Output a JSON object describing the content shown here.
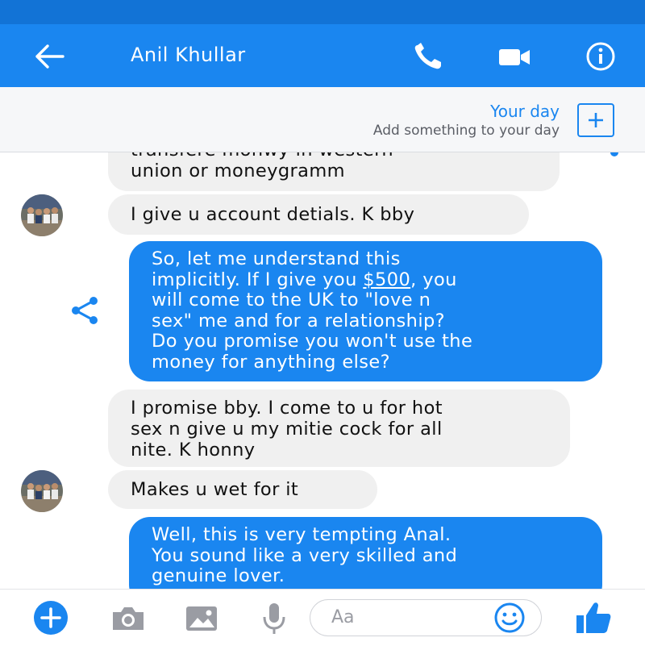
{
  "header": {
    "contact_name": "Anil Khullar",
    "icons": [
      "back-arrow-icon",
      "phone-icon",
      "video-camera-icon",
      "info-icon"
    ]
  },
  "your_day": {
    "title": "Your day",
    "subtitle": "Add something to your day",
    "icon": "add-story-icon"
  },
  "messages": [
    {
      "direction": "in",
      "lines": [
        "transfere monwy in western",
        "union or moneygramm"
      ]
    },
    {
      "direction": "in",
      "lines": [
        "I give u account detials. K bby"
      ]
    },
    {
      "direction": "out",
      "lines": [
        "So, let me understand this",
        "implicitly. If I give you ",
        "$500",
        ", you",
        "will come to the UK to \"love n",
        "sex\" me and for a relationship?",
        "Do you promise you won't use the",
        "money for anything else?"
      ]
    },
    {
      "direction": "in",
      "lines": [
        "I promise bby. I come to u for hot",
        "sex n give u my mitie cock for all",
        "nite. K honny"
      ]
    },
    {
      "direction": "in",
      "lines": [
        "Makes u wet for it"
      ]
    },
    {
      "direction": "out",
      "lines": [
        "Well, this is very tempting Anal.",
        "You sound like a very skilled and",
        "genuine lover."
      ]
    }
  ],
  "composer": {
    "placeholder": "Aa",
    "icons": [
      "plus-icon",
      "camera-icon",
      "image-icon",
      "microphone-icon",
      "emoji-icon",
      "thumbs-up-icon"
    ]
  },
  "colors": {
    "header": "#1a86f0",
    "status_bar": "#1273d6",
    "outgoing_bubble": "#1a86f0",
    "incoming_bubble": "#f0f0f0"
  }
}
